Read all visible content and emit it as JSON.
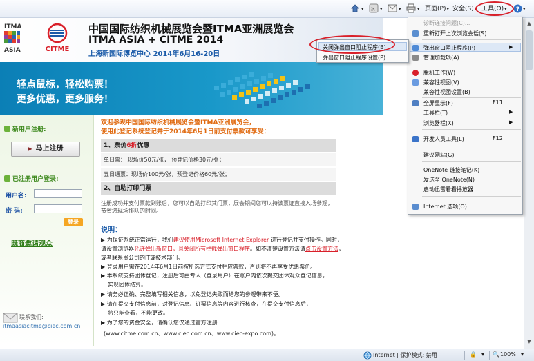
{
  "browser": {
    "page_menu": "页面(P)",
    "safety_menu": "安全(S)",
    "tools_menu": "工具(O)",
    "help_icon": "help-icon"
  },
  "header": {
    "title_cn": "中国国际纺织机械展览会暨ITMA亚洲展览会",
    "title_en": "ITMA ASIA + CITME 2014",
    "venue": "上海新国际博览中心    2014年6月16-20日",
    "logo_itma_text": "ITMA",
    "logo_asia_text": "ASIA",
    "logo_citme_text": "CITME"
  },
  "banner": {
    "slogan1": "轻点鼠标，轻松购票！",
    "slogan2": "更多优惠，更多服务！"
  },
  "sidebar": {
    "new_user_heading": "新用户注册:",
    "register_button": "马上注册",
    "registered_heading": "已注册用户登录:",
    "username_label": "用户名:",
    "password_label": "密  码:",
    "login_button": "登录",
    "group_link": "既商邀请观众",
    "contact_label": "联系我们:",
    "contact_email": "itmaasiacitme@ciec.com.cn"
  },
  "main": {
    "welcome1": "欢迎参观中国国际纺织机械展览会暨ITMA亚洲展览会，",
    "welcome2": "使用此登记系统登记并于2014年6月1日前支付票款可享受：",
    "section1_prefix": "1、票价",
    "section1_highlight": "6折",
    "section1_suffix": "优惠",
    "ticket_single": "单日票：  现场价50元/张，  预登记价格30元/张；",
    "ticket_five": "五日通票：现场价100元/张，预登记价格60元/张；",
    "section2": "2、自助打印门票",
    "section2_note": "注册成功并支付票款到账后，您可以自助打印其门票，展会期间您可以持该票证直接入场参观，节省您现场排队的时间。",
    "explain_heading": "说明：",
    "explain1_a": "为保证系统正常运行，我们",
    "explain1_b": "建议使用Microsoft Internet Explorer",
    "explain1_c": " 进行登记并支付操作。同时，",
    "explain2_a": "请设置浏览器",
    "explain2_b": "允许弹出新窗口，且关闭所有拦截弹出窗口程序",
    "explain2_c": "。如不清楚设置方法请",
    "explain2_d": "点击设置方法",
    "explain2_e": "，",
    "explain3": "或者联系贵公司的IT或技术部门。",
    "explain4": "登录用户需在2014年6月1日前按所选方式支付相应票款，否则将不再享受优惠票价。",
    "explain5": "本系统支持团体登记，注册后可由专人（登录用户）在账户内依次提交团体观众登记信息，",
    "explain6": "实现团体结算。",
    "explain7": "请务必正确、完整填写相关信息，以免登记失败而给您的参观带来不便。",
    "explain8": "请在提交支付信息前，对登记信息、订票信息等内容进行核查，在提交支付信息后，",
    "explain9": "将只能查看，不能更改。",
    "explain10": "为了您的资金安全，请确认您仅通过官方注册",
    "explain11": "(www.citme.com.cn、www.ciec.com.cn、www.ciec-expo.com)。"
  },
  "popup_submenu": {
    "item1": "关闭弹出窗口阻止程序(B)",
    "item2": "弹出窗口阻止程序设置(P)"
  },
  "tools_dropdown": {
    "items": [
      {
        "label": "诊断连接问题(C)...",
        "disabled": true
      },
      {
        "label": "重新打开上次浏览会话(S)"
      },
      {
        "label": "弹出窗口阻止程序(P)",
        "arrow": "▶"
      },
      {
        "label": "管理加载项(A)"
      },
      {
        "label": "脱机工作(W)"
      },
      {
        "label": "兼容性视图(V)"
      },
      {
        "label": "兼容性视图设置(B)"
      },
      {
        "label": "全屏显示(F)",
        "shortcut": "F11"
      },
      {
        "label": "工具栏(T)",
        "arrow": "▶"
      },
      {
        "label": "浏览器栏(X)",
        "arrow": "▶"
      },
      {
        "label": "开发人员工具(L)",
        "shortcut": "F12"
      },
      {
        "label": "建议网站(G)"
      },
      {
        "label": "OneNote 链接笔记(K)"
      },
      {
        "label": "发送至 OneNote(N)"
      },
      {
        "label": "启动迅雷看看播放器"
      },
      {
        "label": "Internet 选项(O)"
      }
    ]
  },
  "statusbar": {
    "zone": "Internet | 保护模式: 禁用",
    "zoom": "100%"
  },
  "colors": {
    "accent_red": "#d9202a",
    "brand_blue": "#1a5aa8",
    "banner_blue": "#0b7fb6",
    "sidebar_green": "#3f8a1f",
    "welcome_orange": "#e06a10"
  }
}
